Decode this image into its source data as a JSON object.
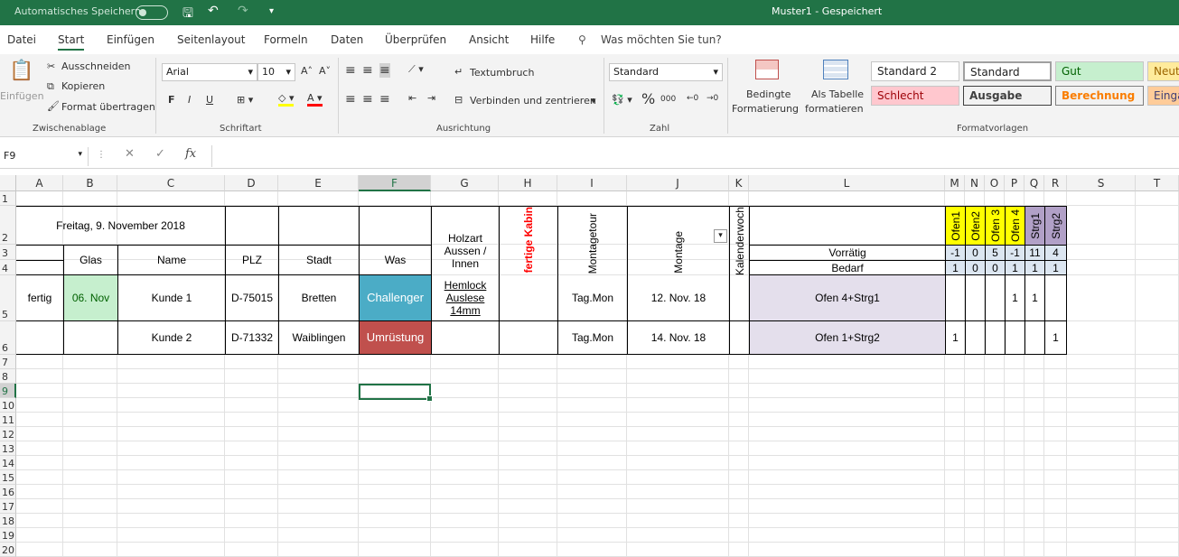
{
  "titlebar": {
    "autosave": "Automatisches Speichern",
    "doc_title": "Muster1  -  Gespeichert"
  },
  "menu": [
    "Datei",
    "Start",
    "Einfügen",
    "Seitenlayout",
    "Formeln",
    "Daten",
    "Überprüfen",
    "Ansicht",
    "Hilfe"
  ],
  "tellme": "Was möchten Sie tun?",
  "ribbon": {
    "clipboard": {
      "paste": "Einfügen",
      "cut": "Ausschneiden",
      "copy": "Kopieren",
      "format": "Format übertragen",
      "label": "Zwischenablage"
    },
    "font": {
      "name": "Arial",
      "size": "10",
      "bold": "F",
      "italic": "I",
      "underline": "U",
      "label": "Schriftart"
    },
    "alignment": {
      "wrap": "Textumbruch",
      "merge": "Verbinden und zentrieren",
      "label": "Ausrichtung"
    },
    "number": {
      "format": "Standard",
      "percent": "%",
      "thousands": "000",
      "label": "Zahl"
    },
    "styles": {
      "cond1": "Bedingte",
      "cond2": "Formatierung",
      "table1": "Als Tabelle",
      "table2": "formatieren",
      "cells": [
        "Standard 2",
        "Standard",
        "Gut",
        "Neut",
        "Schlecht",
        "Ausgabe",
        "Berechnung",
        "Einga"
      ],
      "label": "Formatvorlagen"
    }
  },
  "formula_bar": {
    "name_box": "F9",
    "fx": "fx",
    "formula": ""
  },
  "columns": [
    "A",
    "B",
    "C",
    "D",
    "E",
    "F",
    "G",
    "H",
    "I",
    "J",
    "K",
    "L",
    "M",
    "N",
    "O",
    "P",
    "Q",
    "R",
    "S",
    "T"
  ],
  "rows": [
    "1",
    "2",
    "3",
    "4",
    "5",
    "6",
    "7",
    "8",
    "9",
    "10",
    "11",
    "12",
    "13",
    "14",
    "15",
    "16",
    "17",
    "18",
    "19",
    "20"
  ],
  "sheet": {
    "date_title": "Freitag, 9. November 2018",
    "h_glas": "Glas",
    "h_name": "Name",
    "h_plz": "PLZ",
    "h_stadt": "Stadt",
    "h_was": "Was",
    "h_holzart": "Holzart Aussen / Innen",
    "h_kabine": "fertige Kabin",
    "h_montagetour": "Montagetour",
    "h_montage": "Montage",
    "h_kw": "Kalenderwoch",
    "h_ofen1": "Ofen1",
    "h_ofen2": "Ofen2",
    "h_ofen3": "Ofen 3",
    "h_ofen4": "Ofen 4",
    "h_strg1": "Strg1",
    "h_strg2": "Strg2",
    "vorraetig": "Vorrätig",
    "bedarf": "Bedarf",
    "vor_vals": [
      "-1",
      "0",
      "5",
      "-1",
      "11",
      "4"
    ],
    "bed_vals": [
      "1",
      "0",
      "0",
      "1",
      "1",
      "1"
    ],
    "r5": {
      "status": "fertig",
      "glas": "06. Nov",
      "name": "Kunde 1",
      "plz": "D-75015",
      "stadt": "Bretten",
      "was": "Challenger",
      "holz": "Hemlock Auslese 14mm",
      "tour": "Tag.Mon",
      "montage": "12. Nov. 18",
      "desc": "Ofen 4+Strg1",
      "p": "1",
      "q": "1"
    },
    "r6": {
      "name": "Kunde 2",
      "plz": "D-71332",
      "stadt": "Waiblingen",
      "was": "Umrüstung",
      "tour": "Tag.Mon",
      "montage": "14. Nov. 18",
      "desc": "Ofen 1+Strg2",
      "m": "1",
      "r": "1"
    }
  },
  "colors": {
    "excel_green": "#217346",
    "challenger": "#4bacc6",
    "umruestung": "#c0504d",
    "glas_green": "#c6efce",
    "ofen_yellow": "#ffff00",
    "strg_purple": "#b1a0c7",
    "lavender": "#e4dfec",
    "light_blue": "#dce6f1"
  }
}
